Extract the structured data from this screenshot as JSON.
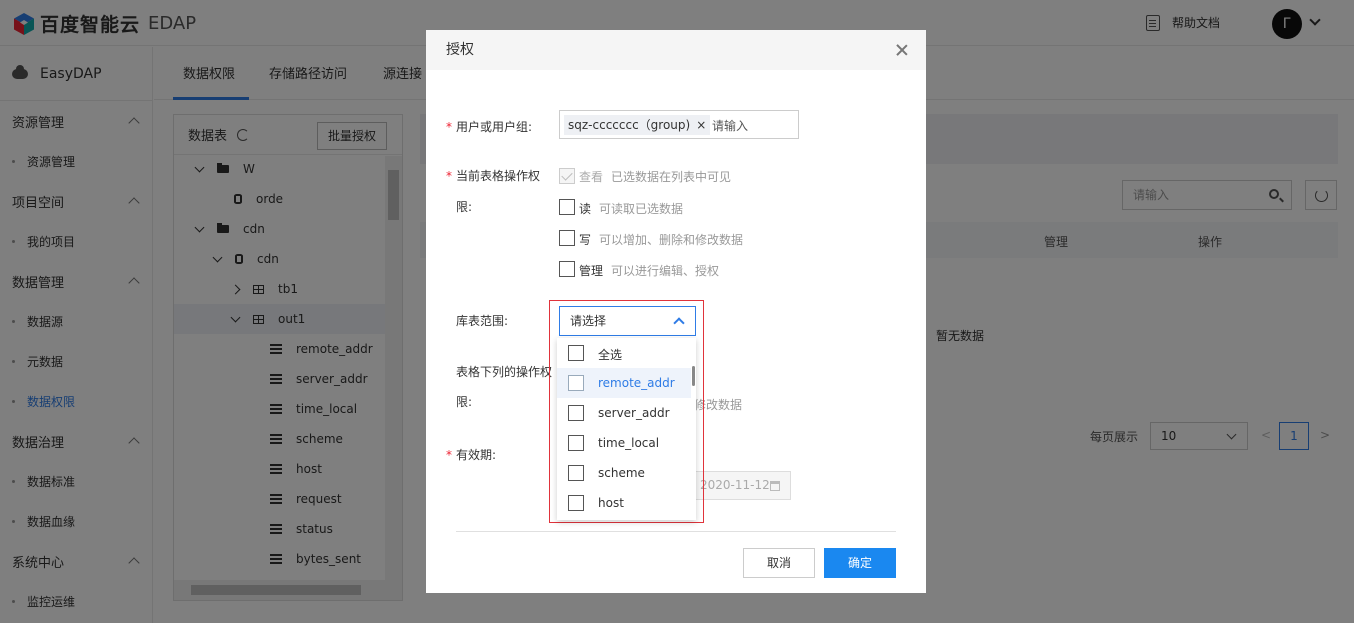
{
  "topbar": {
    "brand": "百度智能云",
    "product": "EDAP",
    "help_label": "帮助文档",
    "avatar_letter": "Г"
  },
  "sidebar": {
    "brand": "EasyDAP",
    "groups": [
      {
        "label": "资源管理",
        "items": [
          {
            "label": "资源管理"
          }
        ]
      },
      {
        "label": "项目空间",
        "items": [
          {
            "label": "我的项目"
          }
        ]
      },
      {
        "label": "数据管理",
        "items": [
          {
            "label": "数据源"
          },
          {
            "label": "元数据"
          },
          {
            "label": "数据权限",
            "active": true
          }
        ]
      },
      {
        "label": "数据治理",
        "items": [
          {
            "label": "数据标准"
          },
          {
            "label": "数据血缘"
          }
        ]
      },
      {
        "label": "系统中心",
        "items": [
          {
            "label": "监控运维"
          }
        ]
      }
    ]
  },
  "tabs": [
    {
      "label": "数据权限",
      "active": true
    },
    {
      "label": "存储路径访问"
    },
    {
      "label": "源连接"
    }
  ],
  "tree": {
    "title": "数据表",
    "batch_button": "批量授权",
    "rows": [
      {
        "label": "W",
        "type": "folder",
        "expanded": true
      },
      {
        "label": "orde",
        "type": "db"
      },
      {
        "label": "cdn",
        "type": "folder",
        "expanded": true
      },
      {
        "label": "cdn",
        "type": "db",
        "expanded": true
      },
      {
        "label": "tb1",
        "type": "table",
        "expanded": false
      },
      {
        "label": "out1",
        "type": "table",
        "expanded": true,
        "selected": true
      },
      {
        "label": "remote_addr",
        "type": "column"
      },
      {
        "label": "server_addr",
        "type": "column"
      },
      {
        "label": "time_local",
        "type": "column"
      },
      {
        "label": "scheme",
        "type": "column"
      },
      {
        "label": "host",
        "type": "column"
      },
      {
        "label": "request",
        "type": "column"
      },
      {
        "label": "status",
        "type": "column"
      },
      {
        "label": "bytes_sent",
        "type": "column"
      }
    ]
  },
  "content": {
    "search_placeholder": "请输入",
    "table_headers": [
      "管理",
      "操作"
    ],
    "empty_text": "暂无数据",
    "pager_label": "每页展示",
    "page_size": "10",
    "current_page": "1",
    "prev": "<",
    "next": ">"
  },
  "modal": {
    "title": "授权",
    "user_label": "用户或用户组:",
    "user_tag": "sqz-ccccccc（group)",
    "user_placeholder": "请输入",
    "perm_label_line1": "当前表格操作权",
    "perm_label_line2": "限:",
    "permissions": [
      {
        "label": "查看",
        "desc": "已选数据在列表中可见",
        "checked": true,
        "disabled": true
      },
      {
        "label": "读",
        "desc": "可读取已选数据",
        "checked": false
      },
      {
        "label": "写",
        "desc": "可以增加、删除和修改数据",
        "checked": false
      },
      {
        "label": "管理",
        "desc": "可以进行编辑、授权",
        "checked": false
      }
    ],
    "scope_label": "库表范围:",
    "scope_placeholder": "请选择",
    "scope_options": [
      {
        "label": "全选",
        "checked": false
      },
      {
        "label": "remote_addr",
        "checked": false,
        "hover": true
      },
      {
        "label": "server_addr",
        "checked": false
      },
      {
        "label": "time_local",
        "checked": false
      },
      {
        "label": "scheme",
        "checked": false
      },
      {
        "label": "host",
        "checked": false
      }
    ],
    "col_perm_label_line1": "表格下列的操作权",
    "col_perm_label_line2": "限:",
    "col_perm_partial_desc": "修改数据",
    "validity_label": "有效期:",
    "validity_date": "2020-11-12",
    "cancel": "取消",
    "ok": "确定"
  }
}
